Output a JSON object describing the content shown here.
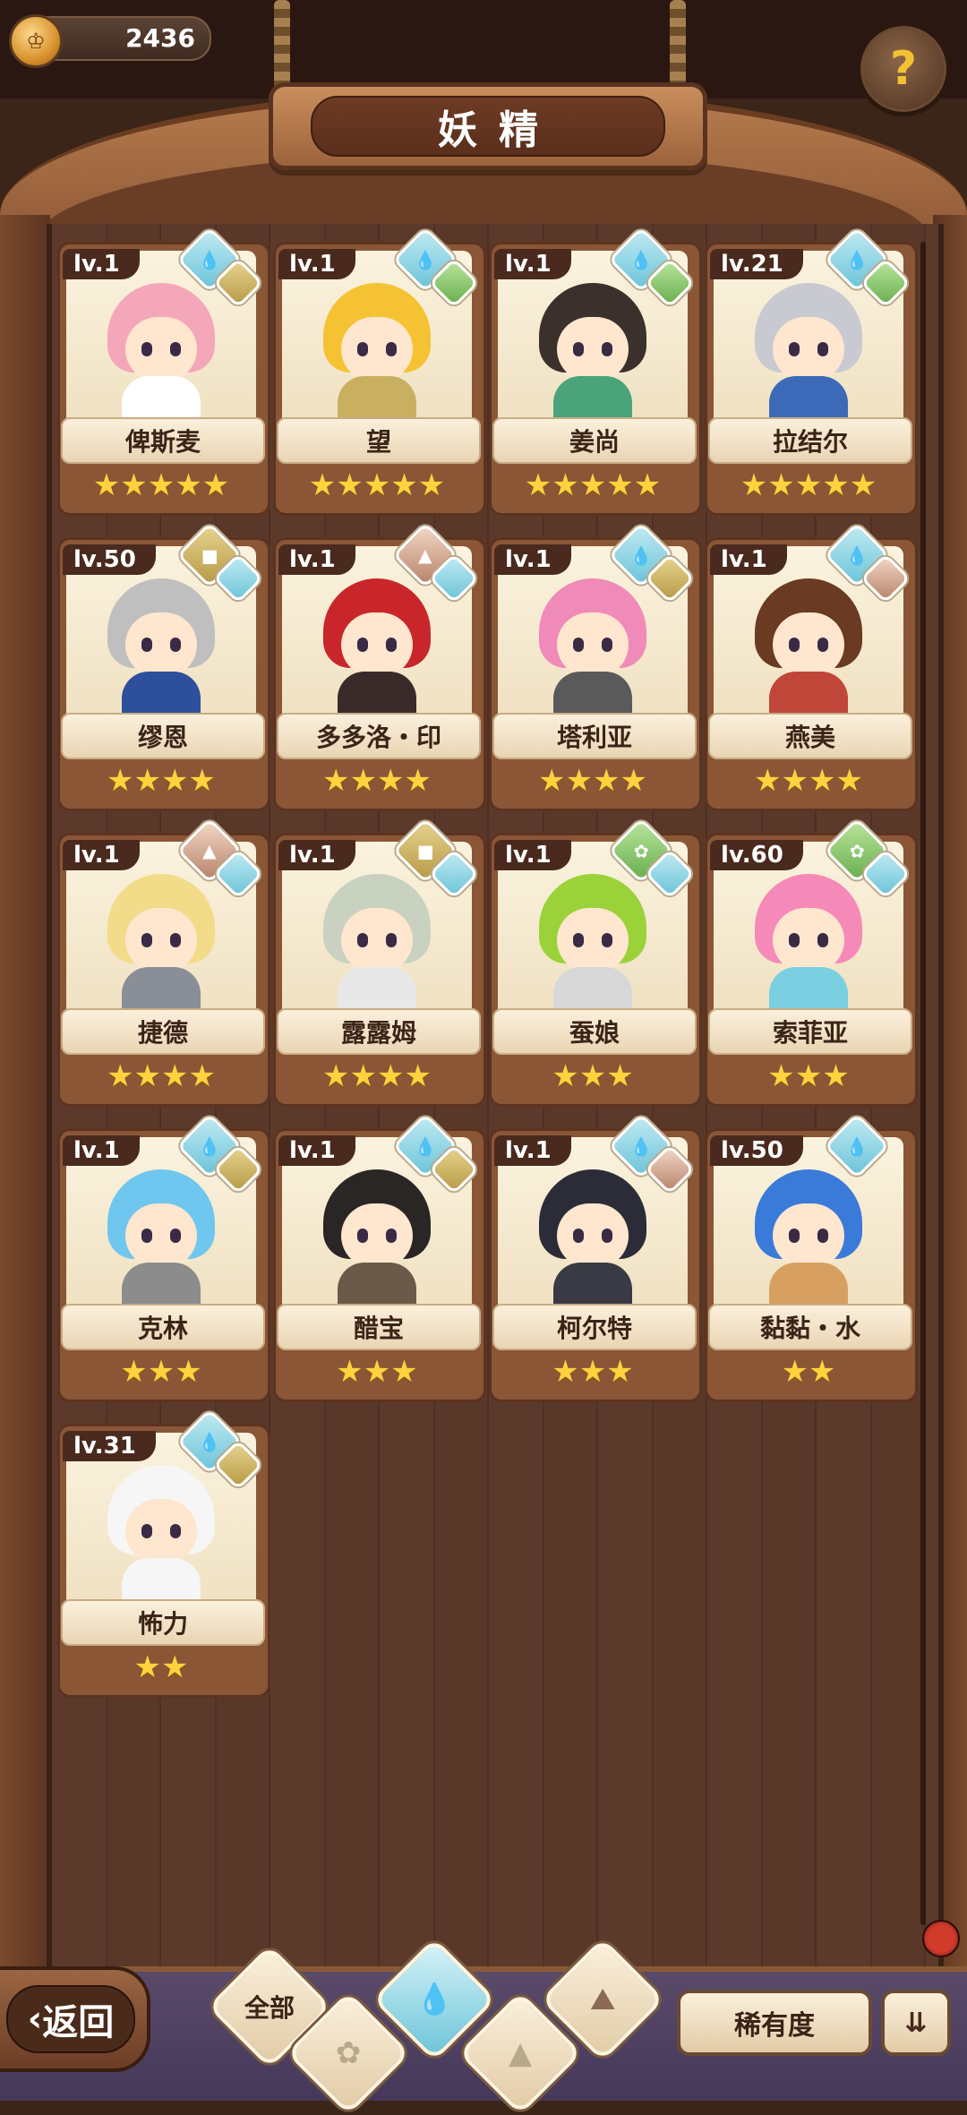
{
  "header": {
    "currency_amount": "2436",
    "title": "妖精",
    "help_symbol": "?"
  },
  "icons": {
    "water": "water-drop",
    "earth": "earth-square",
    "plant": "sprout",
    "mountain": "mountain"
  },
  "colors": {
    "water": "#6cc4d9",
    "earth": "#b79a45",
    "plant": "#6aae4f",
    "mountain": "#b8836a",
    "star": "#ffd23e"
  },
  "fairies": [
    {
      "level": "lv.1",
      "name": "俾斯麦",
      "stars": "★★★★★",
      "rarity": 5,
      "elements": [
        "water",
        "earth"
      ],
      "hair": "#f4a7b8",
      "body": "#ffffff"
    },
    {
      "level": "lv.1",
      "name": "望",
      "stars": "★★★★★",
      "rarity": 5,
      "elements": [
        "water",
        "plant"
      ],
      "hair": "#f5c233",
      "body": "#c9b060"
    },
    {
      "level": "lv.1",
      "name": "姜尚",
      "stars": "★★★★★",
      "rarity": 5,
      "elements": [
        "water",
        "plant"
      ],
      "hair": "#3a302c",
      "body": "#4aa37a"
    },
    {
      "level": "lv.21",
      "name": "拉结尔",
      "stars": "★★★★★",
      "rarity": 5,
      "elements": [
        "water",
        "plant"
      ],
      "hair": "#c9c9d2",
      "body": "#3c6ab8"
    },
    {
      "level": "lv.50",
      "name": "缪恩",
      "stars": "★★★★",
      "rarity": 4,
      "elements": [
        "earth",
        "water"
      ],
      "hair": "#bfbfbf",
      "body": "#2d4f9c"
    },
    {
      "level": "lv.1",
      "name": "多多洛・印",
      "stars": "★★★★",
      "rarity": 4,
      "elements": [
        "mountain",
        "water"
      ],
      "hair": "#c8262a",
      "body": "#3a2a2a"
    },
    {
      "level": "lv.1",
      "name": "塔利亚",
      "stars": "★★★★",
      "rarity": 4,
      "elements": [
        "water",
        "earth"
      ],
      "hair": "#f08ab8",
      "body": "#5a5a5a"
    },
    {
      "level": "lv.1",
      "name": "燕美",
      "stars": "★★★★",
      "rarity": 4,
      "elements": [
        "water",
        "mountain"
      ],
      "hair": "#6a3a22",
      "body": "#c0463a"
    },
    {
      "level": "lv.1",
      "name": "捷德",
      "stars": "★★★★",
      "rarity": 4,
      "elements": [
        "mountain",
        "water"
      ],
      "hair": "#f2dc8a",
      "body": "#8a8e96"
    },
    {
      "level": "lv.1",
      "name": "露露姆",
      "stars": "★★★★",
      "rarity": 4,
      "elements": [
        "earth",
        "water"
      ],
      "hair": "#c9d2c0",
      "body": "#e8e8e8"
    },
    {
      "level": "lv.1",
      "name": "蚕娘",
      "stars": "★★★",
      "rarity": 3,
      "elements": [
        "plant",
        "water"
      ],
      "hair": "#9bd23a",
      "body": "#d8d8d8"
    },
    {
      "level": "lv.60",
      "name": "索菲亚",
      "stars": "★★★",
      "rarity": 3,
      "elements": [
        "plant",
        "water"
      ],
      "hair": "#f58ab8",
      "body": "#7ad0e0"
    },
    {
      "level": "lv.1",
      "name": "克林",
      "stars": "★★★",
      "rarity": 3,
      "elements": [
        "water",
        "earth"
      ],
      "hair": "#6fc6ee",
      "body": "#8c8c8c"
    },
    {
      "level": "lv.1",
      "name": "醋宝",
      "stars": "★★★",
      "rarity": 3,
      "elements": [
        "water",
        "earth"
      ],
      "hair": "#2a2626",
      "body": "#6b5a4a"
    },
    {
      "level": "lv.1",
      "name": "柯尔特",
      "stars": "★★★",
      "rarity": 3,
      "elements": [
        "water",
        "mountain"
      ],
      "hair": "#2c2c38",
      "body": "#3a3a44"
    },
    {
      "level": "lv.50",
      "name": "黏黏・水",
      "stars": "★★",
      "rarity": 2,
      "elements": [
        "water"
      ],
      "hair": "#3a7ad8",
      "body": "#d8a060"
    },
    {
      "level": "lv.31",
      "name": "怖力",
      "stars": "★★",
      "rarity": 2,
      "elements": [
        "water",
        "earth"
      ],
      "hair": "#f6f6f6",
      "body": "#f6f6f6"
    }
  ],
  "bottom": {
    "back_label": "返回",
    "filter_all": "全部",
    "rarity_label": "稀有度",
    "sort_symbol": "⇊"
  }
}
